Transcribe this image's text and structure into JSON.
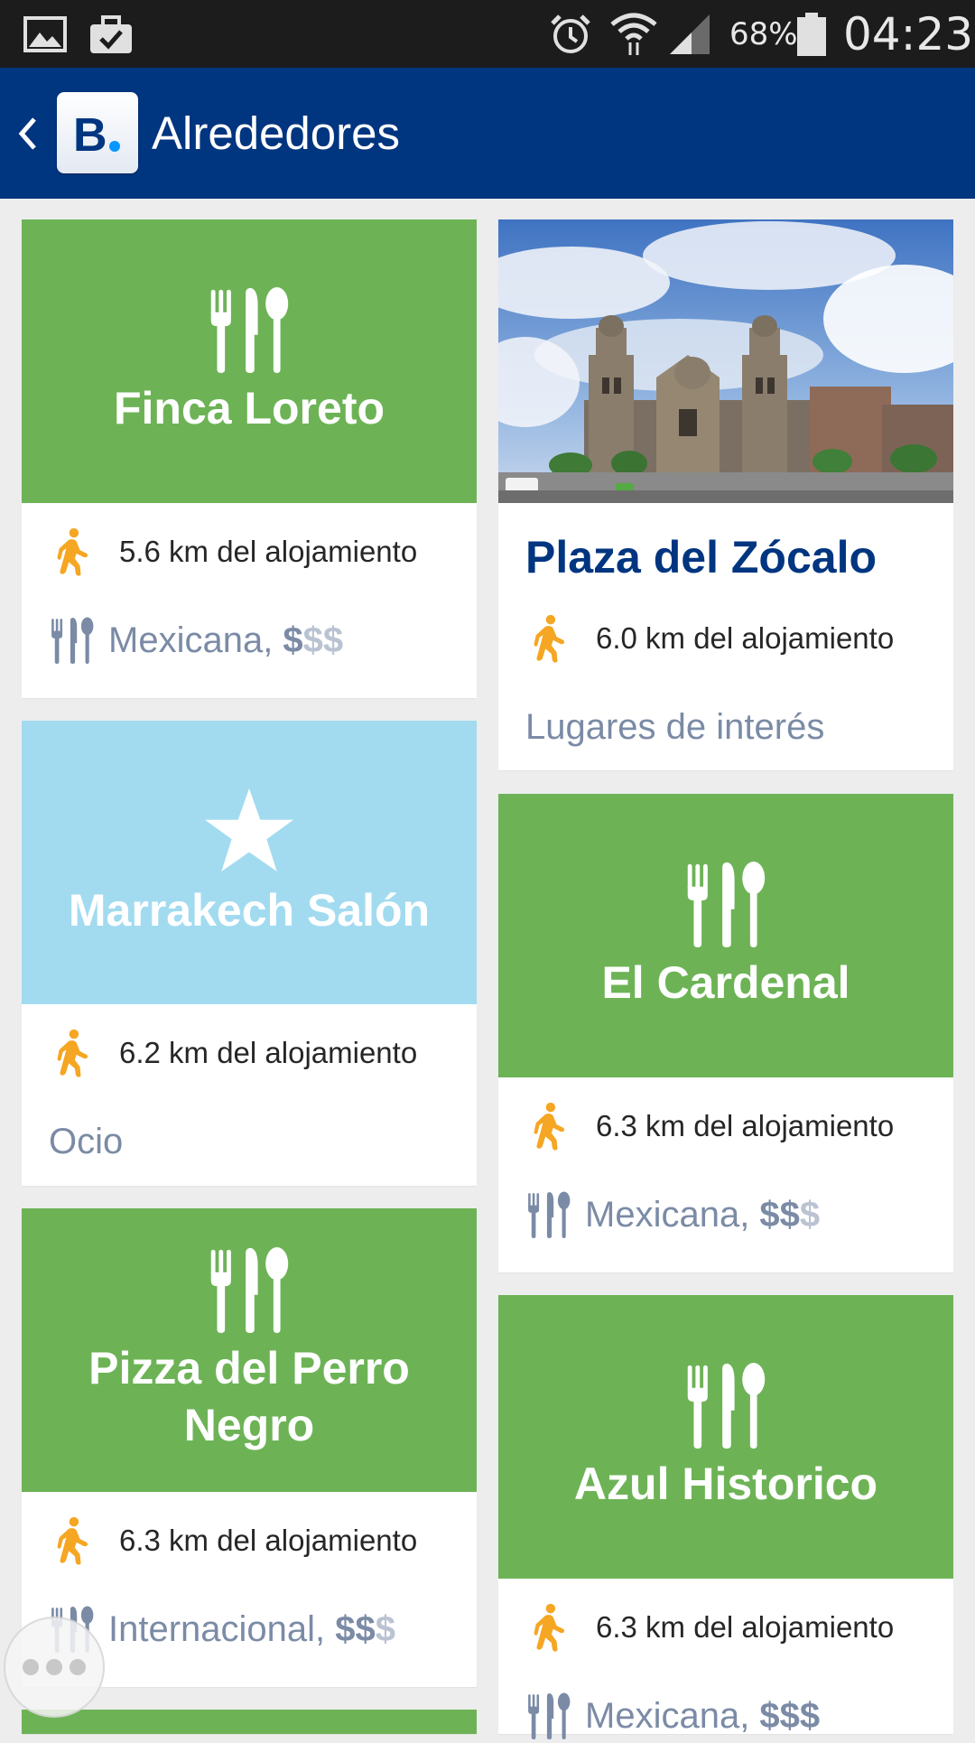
{
  "status_bar": {
    "battery": "68%",
    "time": "04:23",
    "icons": [
      "gallery-icon",
      "briefcase-check-icon",
      "alarm-icon",
      "wifi-icon",
      "signal-icon",
      "battery-icon"
    ]
  },
  "app_bar": {
    "back_icon": "chevron-left-icon",
    "logo_text": "B.",
    "title": "Alrededores",
    "colors": {
      "background": "#003580",
      "logo_dot": "#0896ff"
    }
  },
  "colors": {
    "restaurant_header": "#6db356",
    "leisure_header": "#a2dbf0",
    "category_text": "#7b8ba6",
    "price_inactive": "#bac3d2",
    "walk_icon": "#f5a623",
    "poi_title": "#003580"
  },
  "left_column": [
    {
      "name": "Finca Loreto",
      "type": "restaurant",
      "header_icon": "cutlery-icon",
      "distance": "5.6 km del alojamiento",
      "category": "Mexicana, ",
      "price_on": "$",
      "price_off": "$$"
    },
    {
      "name": "Marrakech Salón",
      "type": "leisure",
      "header_icon": "star-icon",
      "distance": "6.2 km del alojamiento",
      "category": "Ocio"
    },
    {
      "name": "Pizza del Perro Negro",
      "type": "restaurant",
      "header_icon": "cutlery-icon",
      "distance": "6.3 km del alojamiento",
      "category": "Internacional, ",
      "price_on": "$$",
      "price_off": "$"
    }
  ],
  "right_column": [
    {
      "name": "Plaza del Zócalo",
      "type": "landmark",
      "header_image": "cathedral-photo",
      "distance": "6.0 km del alojamiento",
      "category": "Lugares de interés"
    },
    {
      "name": "El Cardenal",
      "type": "restaurant",
      "header_icon": "cutlery-icon",
      "distance": "6.3 km del alojamiento",
      "category": "Mexicana, ",
      "price_on": "$$",
      "price_off": "$"
    },
    {
      "name": "Azul Historico",
      "type": "restaurant",
      "header_icon": "cutlery-icon",
      "distance": "6.3 km del alojamiento",
      "category": "Mexicana, ",
      "price_on": "$$$",
      "price_off": ""
    }
  ],
  "floating_button": {
    "icon": "more-dots-icon"
  }
}
